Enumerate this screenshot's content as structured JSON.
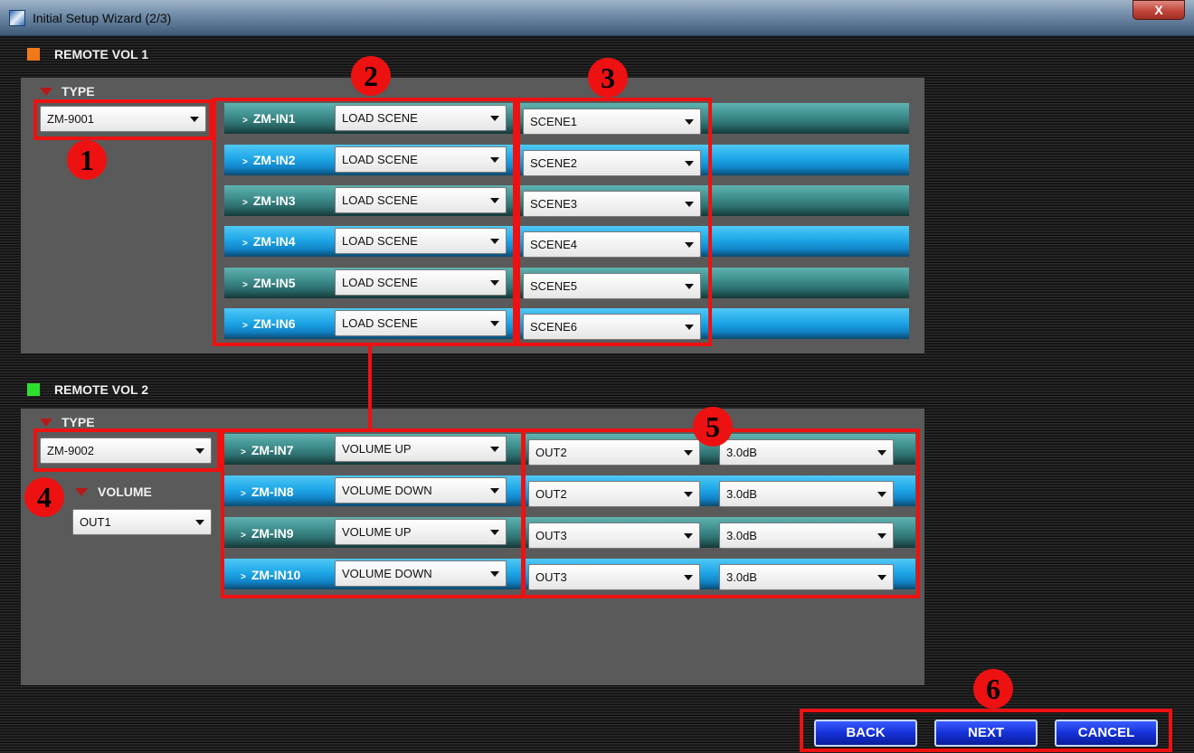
{
  "window": {
    "title": "Initial Setup Wizard (2/3)",
    "close_label": "X"
  },
  "remote1": {
    "heading": "REMOTE VOL 1",
    "type_label": "TYPE",
    "type_value": "ZM-9001",
    "rows": [
      {
        "input": "ZM-IN1",
        "function": "LOAD SCENE",
        "target": "SCENE1"
      },
      {
        "input": "ZM-IN2",
        "function": "LOAD SCENE",
        "target": "SCENE2"
      },
      {
        "input": "ZM-IN3",
        "function": "LOAD SCENE",
        "target": "SCENE3"
      },
      {
        "input": "ZM-IN4",
        "function": "LOAD SCENE",
        "target": "SCENE4"
      },
      {
        "input": "ZM-IN5",
        "function": "LOAD SCENE",
        "target": "SCENE5"
      },
      {
        "input": "ZM-IN6",
        "function": "LOAD SCENE",
        "target": "SCENE6"
      }
    ]
  },
  "remote2": {
    "heading": "REMOTE VOL 2",
    "type_label": "TYPE",
    "type_value": "ZM-9002",
    "volume_label": "VOLUME",
    "volume_value": "OUT1",
    "rows": [
      {
        "input": "ZM-IN7",
        "function": "VOLUME UP",
        "output": "OUT2",
        "step": "3.0dB"
      },
      {
        "input": "ZM-IN8",
        "function": "VOLUME DOWN",
        "output": "OUT2",
        "step": "3.0dB"
      },
      {
        "input": "ZM-IN9",
        "function": "VOLUME UP",
        "output": "OUT3",
        "step": "3.0dB"
      },
      {
        "input": "ZM-IN10",
        "function": "VOLUME DOWN",
        "output": "OUT3",
        "step": "3.0dB"
      }
    ]
  },
  "callouts": [
    "1",
    "2",
    "3",
    "4",
    "5",
    "6"
  ],
  "buttons": {
    "back": "BACK",
    "next": "NEXT",
    "cancel": "CANCEL"
  },
  "colors": {
    "remote1_marker": "#f07a1a",
    "remote2_marker": "#2ee02e",
    "highlight": "#ee1111",
    "nav_button": "#1531d8"
  },
  "icons": {
    "app": "app-logo-icon",
    "expander": "triangle-down-icon",
    "dropdown": "chevron-down-icon",
    "input_marker": "chevron-right-icon"
  }
}
